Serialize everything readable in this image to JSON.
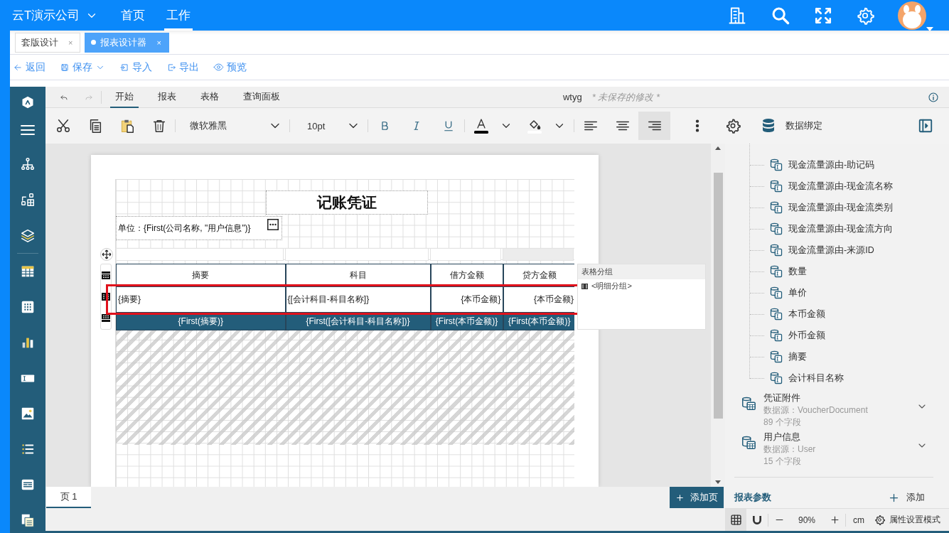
{
  "header": {
    "company": "云T演示公司",
    "nav": [
      {
        "label": "首页",
        "selected": false
      },
      {
        "label": "工作",
        "selected": true
      }
    ]
  },
  "doc_tabs": [
    {
      "label": "套版设计",
      "selected": false,
      "close": "×"
    },
    {
      "label": "报表设计器",
      "selected": true,
      "close": "×"
    }
  ],
  "actions": [
    {
      "kind": "back",
      "label": "返回"
    },
    {
      "kind": "save",
      "label": "保存"
    },
    {
      "kind": "import",
      "label": "导入"
    },
    {
      "kind": "export",
      "label": "导出"
    },
    {
      "kind": "preview",
      "label": "预览"
    }
  ],
  "designer": {
    "ribbon_tabs": [
      {
        "label": "开始",
        "selected": true
      },
      {
        "label": "报表",
        "selected": false
      },
      {
        "label": "表格",
        "selected": false
      },
      {
        "label": "查询面板",
        "selected": false
      }
    ],
    "report_name": "wtyg",
    "save_state": "* 未保存的修改 *",
    "font": "微软雅黑",
    "font_size": "10pt",
    "align_buttons": [
      {
        "kind": "left",
        "selected": false
      },
      {
        "kind": "center",
        "selected": false
      },
      {
        "kind": "right",
        "selected": true
      }
    ],
    "data_binding": "数据绑定"
  },
  "report": {
    "title": "记账凭证",
    "unit": "单位：{First(公司名称, \"用户信息\")}",
    "columns": [
      "摘要",
      "科目",
      "借方金额",
      "贷方金额"
    ],
    "detail": [
      "{摘要}",
      "{[会计科目-科目名称]}",
      "{本币金额}",
      "{本币金额}"
    ],
    "footer": [
      "{First(摘要)}",
      "{First([会计科目-科目名称])}",
      "{First(本币金额)}",
      "{First(本币金额)}"
    ],
    "group_panel": {
      "title": "表格分组",
      "items": [
        "<明细分组>"
      ]
    }
  },
  "fields": [
    "现金流量源由-助记码",
    "现金流量源由-现金流名称",
    "现金流量源由-现金流类别",
    "现金流量源由-现金流方向",
    "现金流量源由-来源ID",
    "数量",
    "单价",
    "本币金额",
    "外币金额",
    "摘要",
    "会计科目名称"
  ],
  "datasets": [
    {
      "name": "凭证附件",
      "source": "数据源：VoucherDocument",
      "count": "89 个字段"
    },
    {
      "name": "用户信息",
      "source": "数据源：User",
      "count": "15 个字段"
    }
  ],
  "params": {
    "title": "报表参数",
    "add": "添加"
  },
  "pages": [
    {
      "label": "页 1",
      "selected": true
    }
  ],
  "add_page": "添加页",
  "status": {
    "zoom": "90%",
    "unit": "cm",
    "mode": "属性设置模式"
  }
}
